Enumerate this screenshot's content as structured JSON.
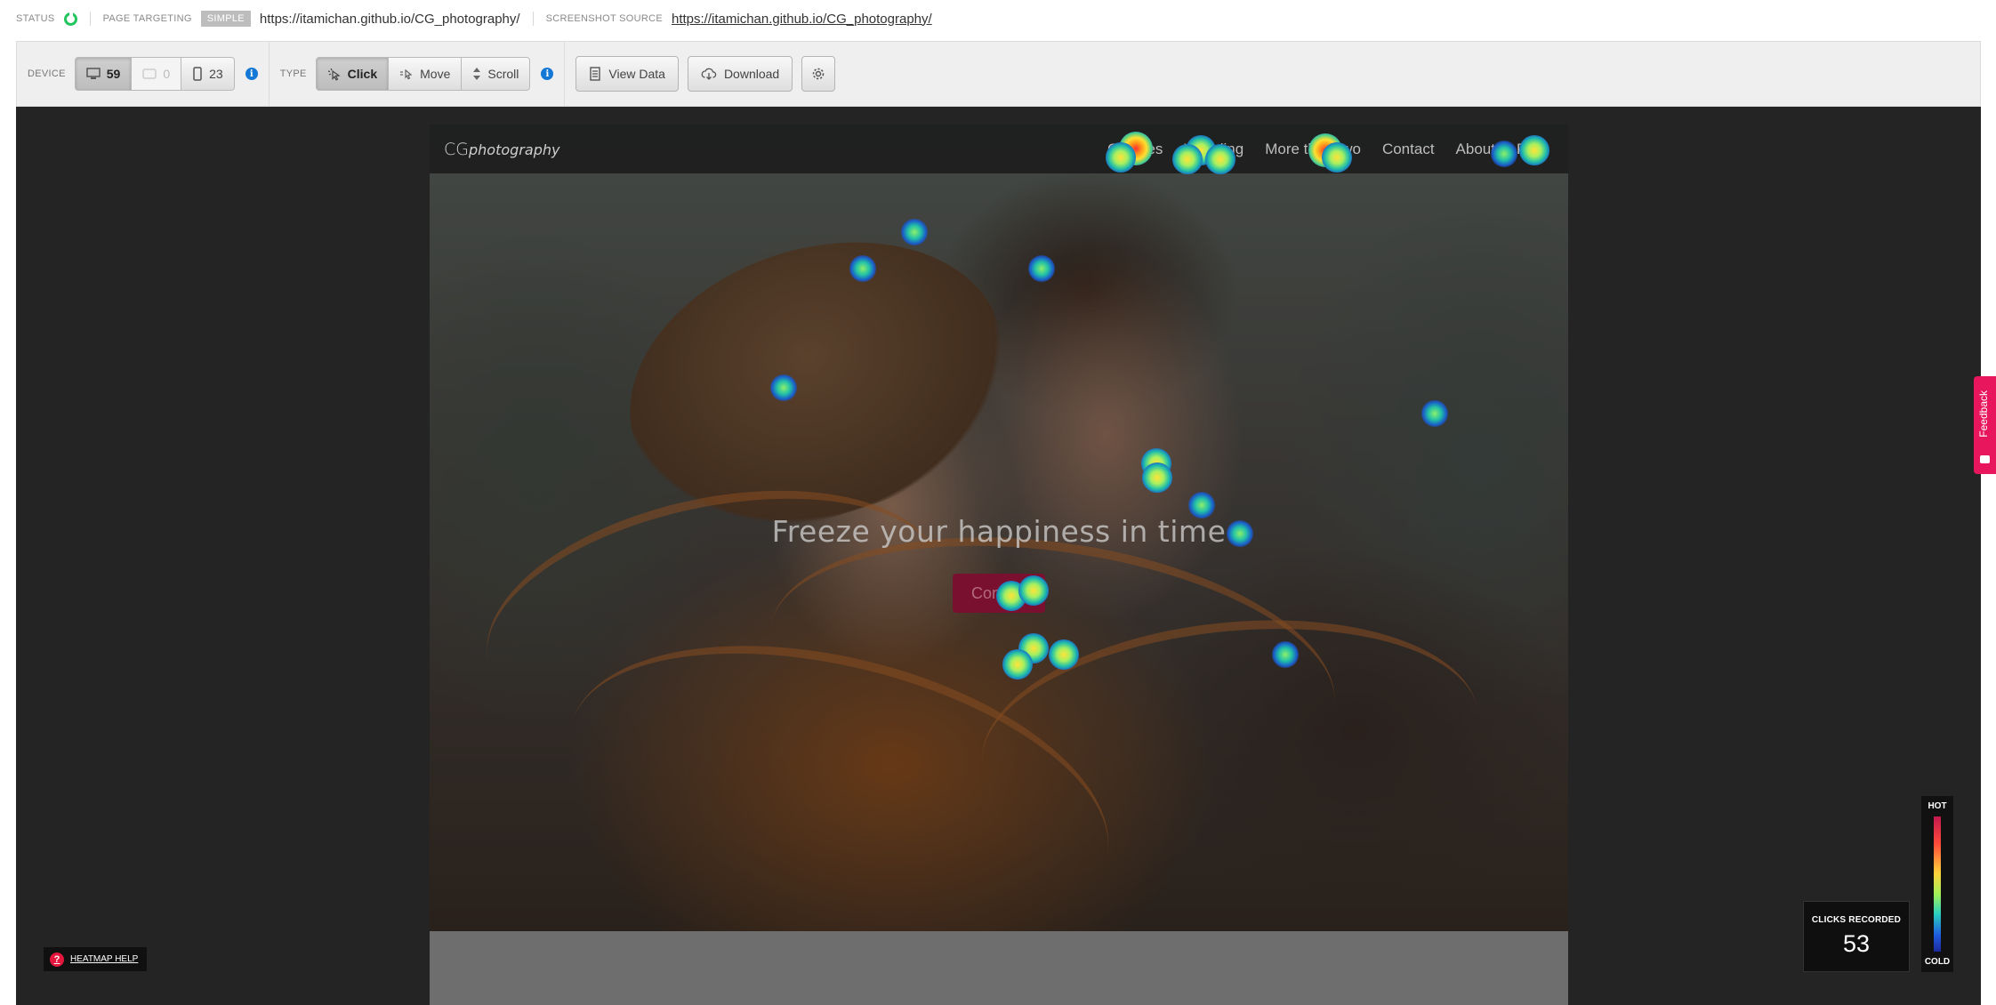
{
  "status": {
    "status_label": "STATUS",
    "page_targeting_label": "PAGE TARGETING",
    "targeting_mode": "SIMPLE",
    "page_url": "https://itamichan.github.io/CG_photography/",
    "screenshot_source_label": "SCREENSHOT SOURCE",
    "screenshot_source_url": "https://itamichan.github.io/CG_photography/"
  },
  "toolbar": {
    "device_label": "DEVICE",
    "device_counts": {
      "desktop": "59",
      "tablet": "0",
      "phone": "23"
    },
    "type_label": "TYPE",
    "type_options": {
      "click": "Click",
      "move": "Move",
      "scroll": "Scroll"
    },
    "active_type": "Click",
    "view_data_label": "View Data",
    "download_label": "Download"
  },
  "site": {
    "brand_main": "CG",
    "brand_italic": "photography",
    "nav": [
      "Couples",
      "Wedding",
      "More than two",
      "Contact",
      "About",
      "FAQ"
    ],
    "headline": "Freeze your happiness in time",
    "cta_label": "Contact"
  },
  "heatmap": {
    "legend_hot": "HOT",
    "legend_cold": "COLD",
    "clicks_label": "CLICKS RECORDED",
    "clicks_value": "53",
    "help_label": "HEATMAP HELP",
    "feedback_label": "Feedback",
    "colors": {
      "hot": "#c2184f",
      "cold": "#1c2a9a",
      "accent_red": "#e3173d",
      "cta": "#7a1030"
    }
  }
}
